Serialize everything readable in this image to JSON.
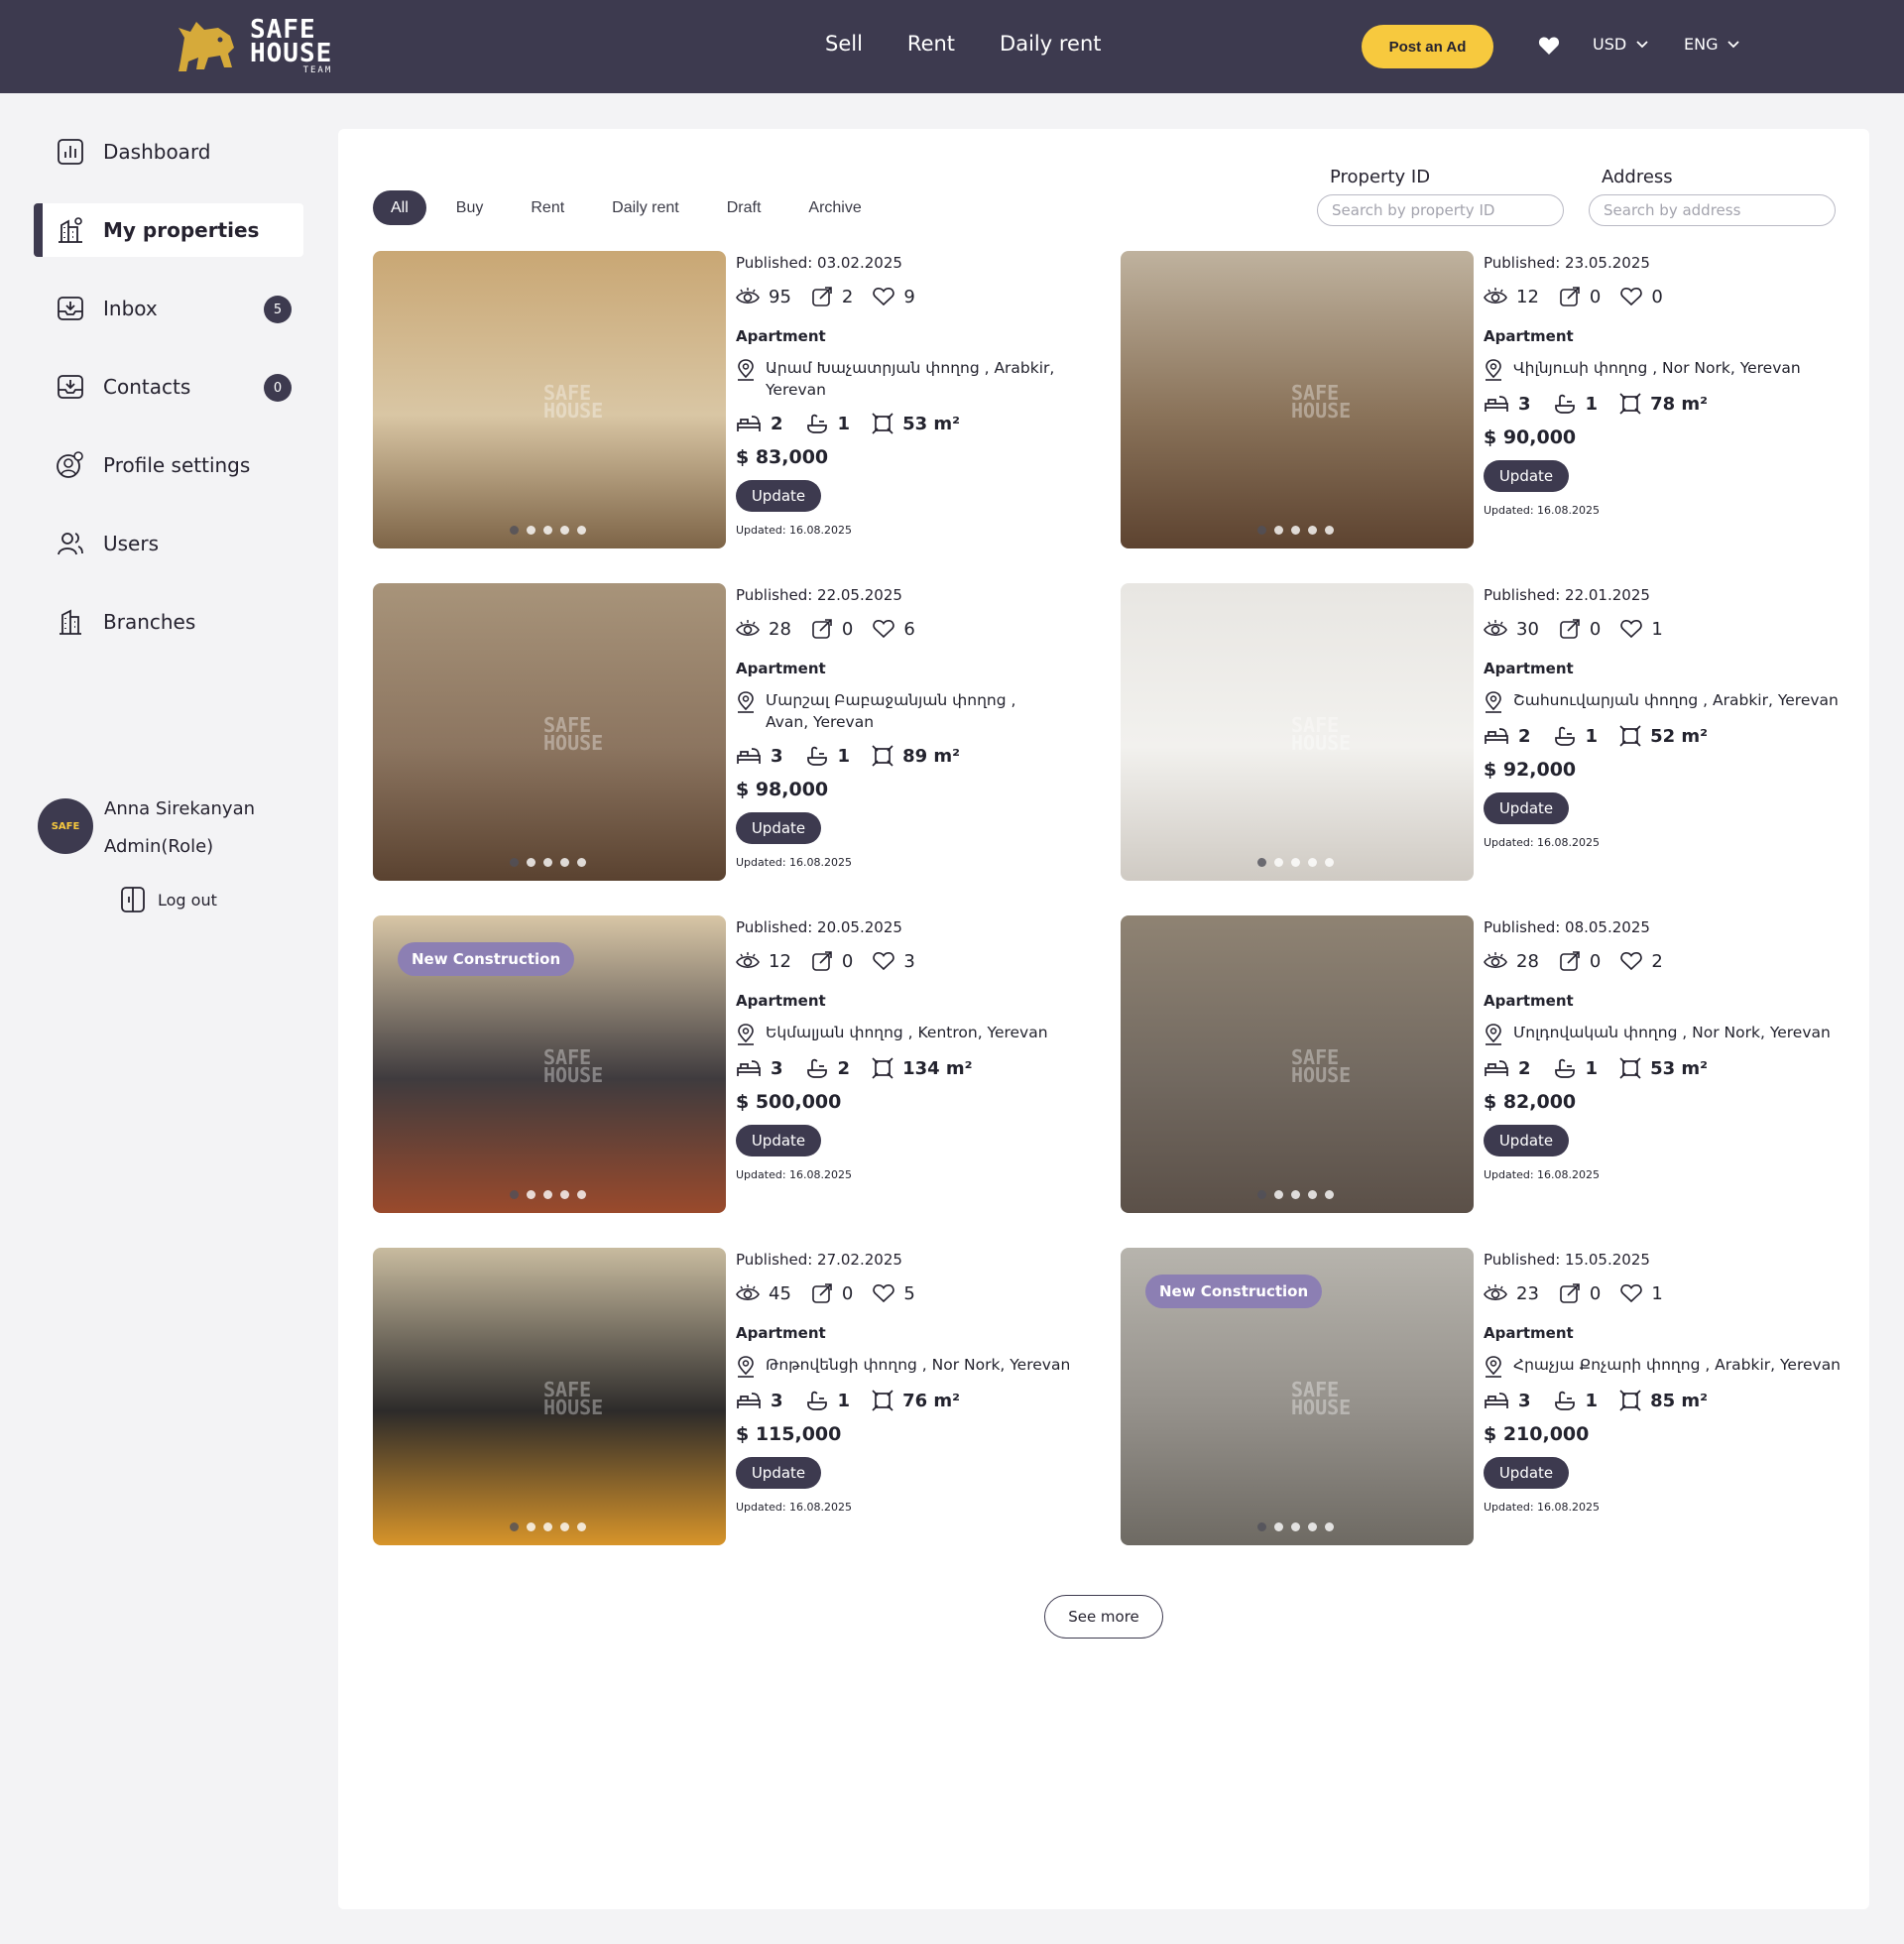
{
  "brand": {
    "line1": "SAFE",
    "line2": "HOUSE",
    "line3": "TEAM"
  },
  "nav": [
    "Sell",
    "Rent",
    "Daily rent"
  ],
  "header": {
    "post_ad": "Post an Ad",
    "currency": "USD",
    "language": "ENG"
  },
  "sidebar": {
    "items": [
      {
        "label": "Dashboard",
        "icon": "dashboard-icon"
      },
      {
        "label": "My properties",
        "icon": "buildings-icon",
        "active": true
      },
      {
        "label": "Inbox",
        "icon": "inbox-icon",
        "badge": "5"
      },
      {
        "label": "Contacts",
        "icon": "contacts-icon",
        "badge": "0"
      },
      {
        "label": "Profile settings",
        "icon": "profile-settings-icon"
      },
      {
        "label": "Users",
        "icon": "users-icon"
      },
      {
        "label": "Branches",
        "icon": "branches-icon"
      }
    ],
    "user": {
      "name": "Anna Sirekanyan",
      "role": "Admin(Role)"
    },
    "logout": "Log out"
  },
  "tabs": [
    "All",
    "Buy",
    "Rent",
    "Daily rent",
    "Draft",
    "Archive"
  ],
  "filters": {
    "property_id_label": "Property ID",
    "property_id_placeholder": "Search by property ID",
    "address_label": "Address",
    "address_placeholder": "Search by address"
  },
  "listings": [
    {
      "published": "Published: 03.02.2025",
      "views": "95",
      "shares": "2",
      "likes": "9",
      "type": "Apartment",
      "address": "Արամ Խաչատրյան փողոց , Arabkir, Yerevan",
      "rooms": "2",
      "baths": "1",
      "area": "53 m²",
      "price": "$ 83,000",
      "update": "Update",
      "updated": "Updated: 16.08.2025",
      "badge": "",
      "photo_colors": [
        "#c9a774",
        "#7d6447",
        "#d9c6a4"
      ]
    },
    {
      "published": "Published: 23.05.2025",
      "views": "12",
      "shares": "0",
      "likes": "0",
      "type": "Apartment",
      "address": "Վիլնյուսի փողոց , Nor Nork, Yerevan",
      "rooms": "3",
      "baths": "1",
      "area": "78 m²",
      "price": "$ 90,000",
      "update": "Update",
      "updated": "Updated: 16.08.2025",
      "badge": "",
      "photo_colors": [
        "#bfb29e",
        "#5d4330",
        "#8a735a"
      ]
    },
    {
      "published": "Published: 22.05.2025",
      "views": "28",
      "shares": "0",
      "likes": "6",
      "type": "Apartment",
      "address": "Մարշալ Բաբաջանյան փողոց , Avan, Yerevan",
      "rooms": "3",
      "baths": "1",
      "area": "89 m²",
      "price": "$ 98,000",
      "update": "Update",
      "updated": "Updated: 16.08.2025",
      "badge": "",
      "photo_colors": [
        "#a8947a",
        "#5a4230",
        "#8c7560"
      ]
    },
    {
      "published": "Published: 22.01.2025",
      "views": "30",
      "shares": "0",
      "likes": "1",
      "type": "Apartment",
      "address": "Շահսուվարյան փողոց , Arabkir, Yerevan",
      "rooms": "2",
      "baths": "1",
      "area": "52 m²",
      "price": "$ 92,000",
      "update": "Update",
      "updated": "Updated: 16.08.2025",
      "badge": "",
      "photo_colors": [
        "#e8e6e2",
        "#cfcac3",
        "#f2f1ee"
      ]
    },
    {
      "published": "Published: 20.05.2025",
      "views": "12",
      "shares": "0",
      "likes": "3",
      "type": "Apartment",
      "address": "Եկմալյան փողոց , Kentron, Yerevan",
      "rooms": "3",
      "baths": "2",
      "area": "134 m²",
      "price": "$ 500,000",
      "update": "Update",
      "updated": "Updated: 16.08.2025",
      "badge": "New Construction",
      "photo_colors": [
        "#d8c6a6",
        "#9a4a2c",
        "#3f3b3e"
      ]
    },
    {
      "published": "Published: 08.05.2025",
      "views": "28",
      "shares": "0",
      "likes": "2",
      "type": "Apartment",
      "address": "Մոլդովական փողոց , Nor Nork, Yerevan",
      "rooms": "2",
      "baths": "1",
      "area": "53 m²",
      "price": "$ 82,000",
      "update": "Update",
      "updated": "Updated: 16.08.2025",
      "badge": "",
      "photo_colors": [
        "#8f8373",
        "#5b5048",
        "#726960"
      ]
    },
    {
      "published": "Published: 27.02.2025",
      "views": "45",
      "shares": "0",
      "likes": "5",
      "type": "Apartment",
      "address": "Թոթովենցի փողոց , Nor Nork, Yerevan",
      "rooms": "3",
      "baths": "1",
      "area": "76 m²",
      "price": "$ 115,000",
      "update": "Update",
      "updated": "Updated: 16.08.2025",
      "badge": "",
      "photo_colors": [
        "#c8bb9f",
        "#d7942a",
        "#2d2b2a"
      ]
    },
    {
      "published": "Published: 15.05.2025",
      "views": "23",
      "shares": "0",
      "likes": "1",
      "type": "Apartment",
      "address": "Հրաչյա Քոչարի փողոց , Arabkir, Yerevan",
      "rooms": "3",
      "baths": "1",
      "area": "85 m²",
      "price": "$ 210,000",
      "update": "Update",
      "updated": "Updated: 16.08.2025",
      "badge": "New Construction",
      "photo_colors": [
        "#b7b4ad",
        "#6e6a63",
        "#94908a"
      ]
    }
  ],
  "see_more": "See more"
}
